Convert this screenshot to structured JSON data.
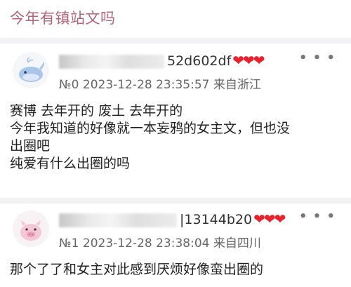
{
  "page_title": "今年有镇站文吗",
  "posts": [
    {
      "uid_suffix": "52d602df",
      "hearts": "❤❤❤",
      "meta": "№0 2023-12-28 23:35:57 来自浙江",
      "more": "• • •",
      "lines": [
        "赛博 去年开的 废土 去年开的",
        "今年我知道的好像就一本妄鸦的女主文，但也没",
        "出圈吧",
        "纯爱有什么出圈的吗"
      ]
    },
    {
      "uid_suffix": "|13144b20",
      "hearts": "❤❤❤",
      "meta": "№1 2023-12-28 23:38:04 来自四川",
      "more": "• • •",
      "lines": [
        "那个了了和女主对此感到厌烦好像蛮出圈的"
      ]
    }
  ],
  "colors": {
    "title": "#b0657a",
    "heart": "#e8222e",
    "divider": "#f2f2f4"
  },
  "icons": {
    "avatar_0": "whale-avatar-icon",
    "avatar_1": "pig-avatar-icon",
    "more": "more-dots-icon"
  }
}
